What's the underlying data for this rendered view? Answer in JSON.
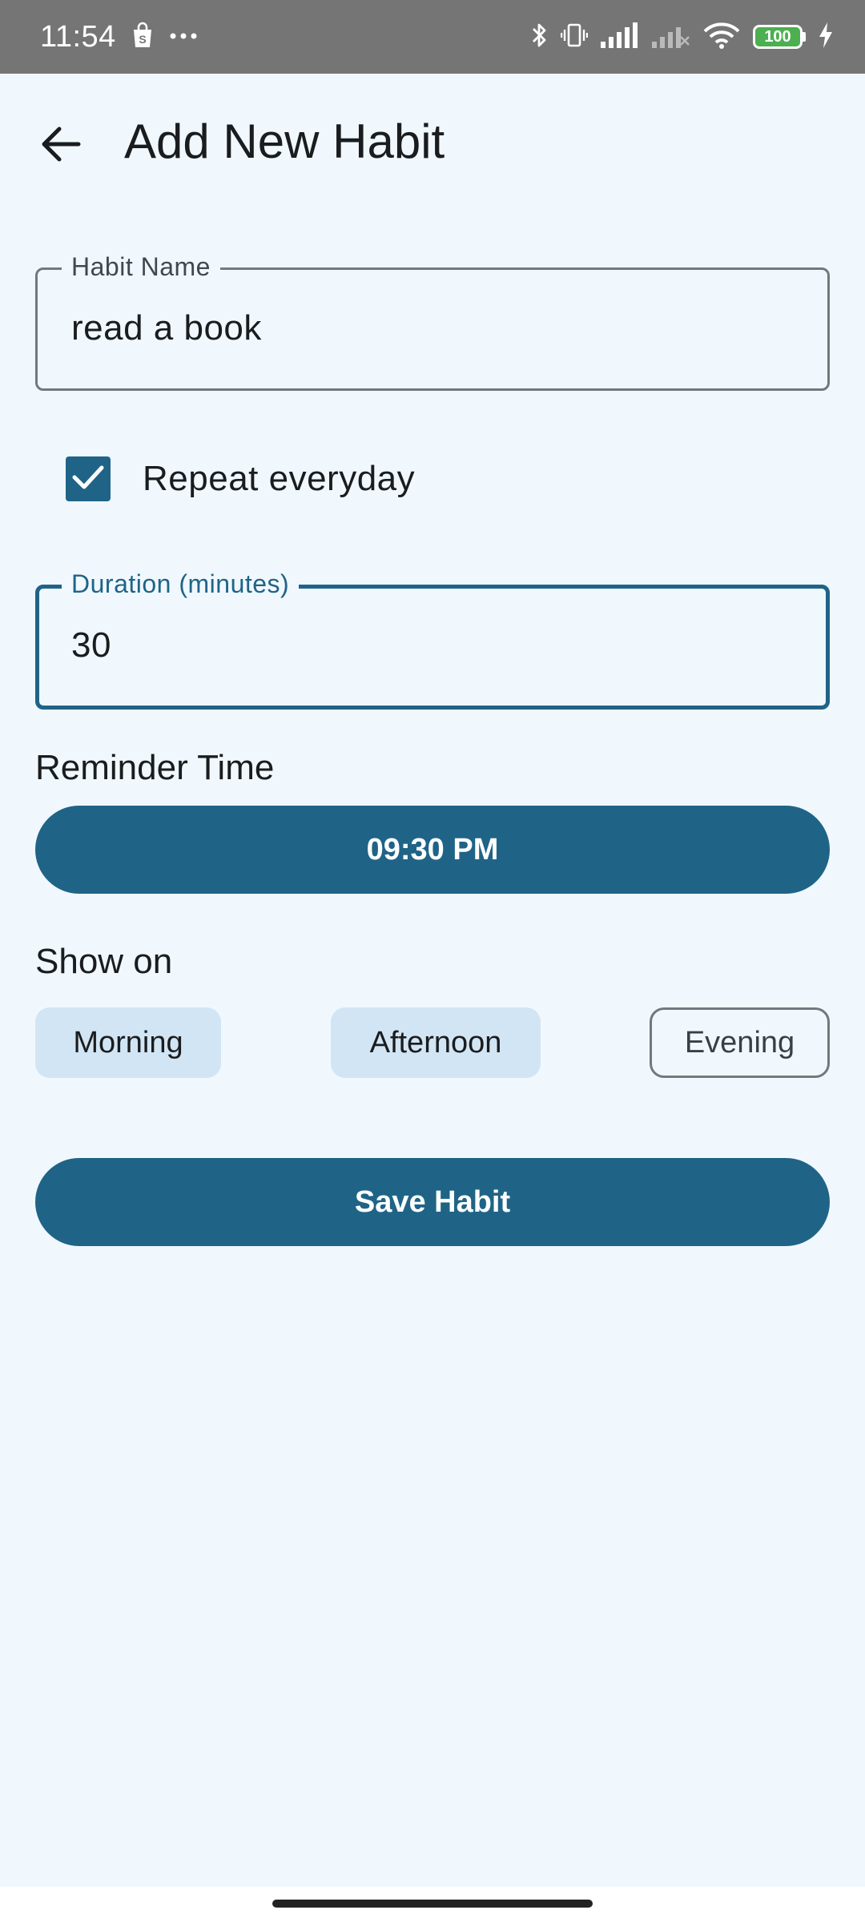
{
  "status_bar": {
    "time": "11:54",
    "battery": "100",
    "icons": [
      "shopping-bag-icon",
      "more-dots-icon",
      "bluetooth-icon",
      "vibrate-icon",
      "signal-icon",
      "signal-off-icon",
      "wifi-icon",
      "battery-icon",
      "charging-icon"
    ]
  },
  "app_bar": {
    "title": "Add New Habit",
    "back_icon": "arrow-back-icon"
  },
  "habit_name": {
    "label": "Habit Name",
    "value": "read a book"
  },
  "repeat": {
    "label": "Repeat everyday",
    "checked": true
  },
  "duration": {
    "label": "Duration (minutes)",
    "value": "30"
  },
  "reminder": {
    "label": "Reminder Time",
    "time": "09:30 PM"
  },
  "show_on": {
    "label": "Show on",
    "options": [
      {
        "label": "Morning",
        "selected": true
      },
      {
        "label": "Afternoon",
        "selected": true
      },
      {
        "label": "Evening",
        "selected": false
      }
    ]
  },
  "save_button": {
    "label": "Save Habit"
  },
  "colors": {
    "primary": "#1f6487",
    "background": "#f0f8fe",
    "chip_selected": "#d2e5f4",
    "status_bar": "#757575"
  }
}
